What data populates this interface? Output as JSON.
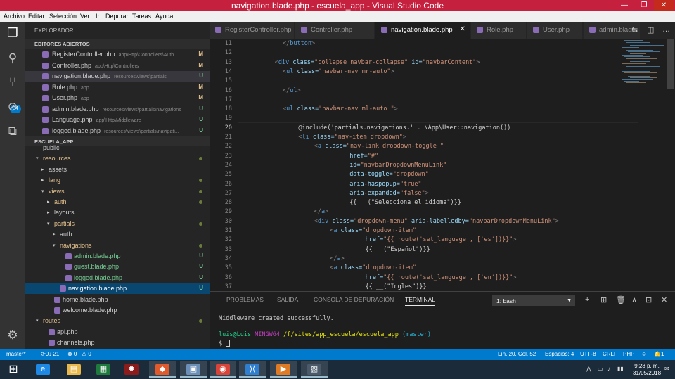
{
  "window": {
    "title": "navigation.blade.php - escuela_app - Visual Studio Code",
    "controls": [
      "—",
      "❐",
      "✕"
    ]
  },
  "colors": {
    "titlebar": "#c5203e",
    "statusbar": "#007acc",
    "modified": "#e2c08d",
    "untracked": "#73c991"
  },
  "menu": [
    "Archivo",
    "Editar",
    "Selección",
    "Ver",
    "Ir",
    "Depurar",
    "Tareas",
    "Ayuda"
  ],
  "activity": {
    "icons": [
      "files-icon",
      "search-icon",
      "source-control-icon",
      "debug-icon",
      "extensions-icon",
      "settings-gear-icon"
    ],
    "scm_badge": "34"
  },
  "explorer": {
    "header": "EXPLORADOR",
    "open_editors_title": "EDITORES ABIERTOS",
    "open_editors": [
      {
        "name": "RegisterController.php",
        "path": "app\\Http\\Controllers\\Auth",
        "status": "M"
      },
      {
        "name": "Controller.php",
        "path": "app\\Http\\Controllers",
        "status": "M"
      },
      {
        "name": "navigation.blade.php",
        "path": "resources\\views\\partials",
        "status": "U"
      },
      {
        "name": "Role.php",
        "path": "app",
        "status": "M"
      },
      {
        "name": "User.php",
        "path": "app",
        "status": "M"
      },
      {
        "name": "admin.blade.php",
        "path": "resources\\views\\partials\\navigations",
        "status": "U"
      },
      {
        "name": "Language.php",
        "path": "app\\Http\\Middleware",
        "status": "U"
      },
      {
        "name": "logged.blade.php",
        "path": "resources\\views\\partials\\navigati...",
        "status": "U"
      }
    ],
    "project_title": "ESCUELA_APP",
    "tree": [
      {
        "label": "public",
        "arrow": "",
        "indent": 0,
        "kind": "folder",
        "status": ""
      },
      {
        "label": "resources",
        "arrow": "▾",
        "indent": 0,
        "kind": "folder",
        "status": "dot"
      },
      {
        "label": "assets",
        "arrow": "▸",
        "indent": 1,
        "kind": "folder",
        "status": ""
      },
      {
        "label": "lang",
        "arrow": "▸",
        "indent": 1,
        "kind": "folder",
        "status": "dot"
      },
      {
        "label": "views",
        "arrow": "▾",
        "indent": 1,
        "kind": "folder",
        "status": "dot"
      },
      {
        "label": "auth",
        "arrow": "▸",
        "indent": 2,
        "kind": "folder",
        "status": "dot"
      },
      {
        "label": "layouts",
        "arrow": "▸",
        "indent": 2,
        "kind": "folder",
        "status": ""
      },
      {
        "label": "partials",
        "arrow": "▾",
        "indent": 2,
        "kind": "folder",
        "status": "dot"
      },
      {
        "label": "auth",
        "arrow": "▸",
        "indent": 3,
        "kind": "folder",
        "status": ""
      },
      {
        "label": "navigations",
        "arrow": "▾",
        "indent": 3,
        "kind": "folder",
        "status": "dot"
      },
      {
        "label": "admin.blade.php",
        "arrow": "",
        "indent": 4,
        "kind": "file",
        "status": "U"
      },
      {
        "label": "guest.blade.php",
        "arrow": "",
        "indent": 4,
        "kind": "file",
        "status": "U"
      },
      {
        "label": "logged.blade.php",
        "arrow": "",
        "indent": 4,
        "kind": "file",
        "status": "U"
      },
      {
        "label": "navigation.blade.php",
        "arrow": "",
        "indent": 3,
        "kind": "file",
        "status": "U",
        "selected": true
      },
      {
        "label": "home.blade.php",
        "arrow": "",
        "indent": 2,
        "kind": "file",
        "status": ""
      },
      {
        "label": "welcome.blade.php",
        "arrow": "",
        "indent": 2,
        "kind": "file",
        "status": ""
      },
      {
        "label": "routes",
        "arrow": "▾",
        "indent": 0,
        "kind": "folder",
        "status": "dot"
      },
      {
        "label": "api.php",
        "arrow": "",
        "indent": 1,
        "kind": "file",
        "status": ""
      },
      {
        "label": "channels.php",
        "arrow": "",
        "indent": 1,
        "kind": "file",
        "status": ""
      }
    ]
  },
  "tabs": [
    {
      "label": "RegisterController.php",
      "active": false
    },
    {
      "label": "Controller.php",
      "active": false
    },
    {
      "label": "navigation.blade.php",
      "active": true,
      "close": "✕"
    },
    {
      "label": "Role.php",
      "active": false
    },
    {
      "label": "User.php",
      "active": false
    },
    {
      "label": "admin.blade",
      "active": false
    }
  ],
  "editor": {
    "current_line": 20,
    "lines": [
      {
        "n": "11",
        "i": 10,
        "t": [
          [
            "t",
            "</"
          ],
          [
            "g",
            "button"
          ],
          [
            "t",
            ">"
          ]
        ]
      },
      {
        "n": "12",
        "i": 0,
        "t": []
      },
      {
        "n": "13",
        "i": 8,
        "t": [
          [
            "t",
            "<"
          ],
          [
            "g",
            "div"
          ],
          [
            "b",
            " class="
          ],
          [
            "o",
            "\"collapse navbar-collapse\""
          ],
          [
            "b",
            " id="
          ],
          [
            "o",
            "\"navbarContent\""
          ],
          [
            "t",
            ">"
          ]
        ]
      },
      {
        "n": "14",
        "i": 10,
        "t": [
          [
            "t",
            "<"
          ],
          [
            "g",
            "ul"
          ],
          [
            "b",
            " class="
          ],
          [
            "o",
            "\"navbar-nav mr-auto\""
          ],
          [
            "t",
            ">"
          ]
        ]
      },
      {
        "n": "15",
        "i": 0,
        "t": []
      },
      {
        "n": "16",
        "i": 10,
        "t": [
          [
            "t",
            "</"
          ],
          [
            "g",
            "ul"
          ],
          [
            "t",
            ">"
          ]
        ]
      },
      {
        "n": "17",
        "i": 0,
        "t": []
      },
      {
        "n": "18",
        "i": 10,
        "t": [
          [
            "t",
            "<"
          ],
          [
            "g",
            "ul"
          ],
          [
            "b",
            " class="
          ],
          [
            "o",
            "\"navbar-nav ml-auto \""
          ],
          [
            "t",
            ">"
          ]
        ]
      },
      {
        "n": "19",
        "i": 0,
        "t": []
      },
      {
        "n": "20",
        "i": 14,
        "t": [
          [
            "t",
            "@include('partials.navigations.' . \\App\\User::navigation())"
          ]
        ]
      },
      {
        "n": "21",
        "i": 14,
        "t": [
          [
            "t",
            "<"
          ],
          [
            "g",
            "li"
          ],
          [
            "b",
            " class="
          ],
          [
            "o",
            "\"nav-item dropdown\""
          ],
          [
            "t",
            ">"
          ]
        ]
      },
      {
        "n": "22",
        "i": 18,
        "t": [
          [
            "t",
            "<"
          ],
          [
            "g",
            "a"
          ],
          [
            "b",
            " class="
          ],
          [
            "o",
            "\"nav-link dropdown-toggle \""
          ]
        ]
      },
      {
        "n": "23",
        "i": 27,
        "t": [
          [
            "b",
            "href="
          ],
          [
            "o",
            "\"#\""
          ]
        ]
      },
      {
        "n": "24",
        "i": 27,
        "t": [
          [
            "b",
            "id="
          ],
          [
            "o",
            "\"navbarDropdownMenuLink\""
          ]
        ]
      },
      {
        "n": "25",
        "i": 27,
        "t": [
          [
            "b",
            "data-toggle="
          ],
          [
            "o",
            "\"dropdown\""
          ]
        ]
      },
      {
        "n": "26",
        "i": 27,
        "t": [
          [
            "b",
            "aria-haspopup="
          ],
          [
            "o",
            "\"true\""
          ]
        ]
      },
      {
        "n": "27",
        "i": 27,
        "t": [
          [
            "b",
            "aria-expanded="
          ],
          [
            "o",
            "\"false\""
          ],
          [
            "t",
            ">"
          ]
        ]
      },
      {
        "n": "28",
        "i": 27,
        "t": [
          [
            "t",
            "{{ __(\"Selecciona el idioma\")}}"
          ]
        ]
      },
      {
        "n": "29",
        "i": 18,
        "t": [
          [
            "t",
            "</"
          ],
          [
            "g",
            "a"
          ],
          [
            "t",
            ">"
          ]
        ]
      },
      {
        "n": "30",
        "i": 18,
        "t": [
          [
            "t",
            "<"
          ],
          [
            "g",
            "div"
          ],
          [
            "b",
            " class="
          ],
          [
            "o",
            "\"dropdown-menu\""
          ],
          [
            "b",
            " aria-labelledby="
          ],
          [
            "o",
            "\"navbarDropdownMenuLink\""
          ],
          [
            "t",
            ">"
          ]
        ]
      },
      {
        "n": "31",
        "i": 22,
        "t": [
          [
            "t",
            "<"
          ],
          [
            "g",
            "a"
          ],
          [
            "b",
            " class="
          ],
          [
            "o",
            "\"dropdown-item\""
          ]
        ]
      },
      {
        "n": "32",
        "i": 31,
        "t": [
          [
            "b",
            "href="
          ],
          [
            "o",
            "\"{{ route('set_language', ['es'])}}\""
          ],
          [
            "t",
            ">"
          ]
        ]
      },
      {
        "n": "33",
        "i": 31,
        "t": [
          [
            "t",
            "{{ __(\"Español\")}}"
          ]
        ]
      },
      {
        "n": "34",
        "i": 22,
        "t": [
          [
            "t",
            "</"
          ],
          [
            "g",
            "a"
          ],
          [
            "t",
            ">"
          ]
        ]
      },
      {
        "n": "35",
        "i": 22,
        "t": [
          [
            "t",
            "<"
          ],
          [
            "g",
            "a"
          ],
          [
            "b",
            " class="
          ],
          [
            "o",
            "\"dropdown-item\""
          ]
        ]
      },
      {
        "n": "36",
        "i": 31,
        "t": [
          [
            "b",
            "href="
          ],
          [
            "o",
            "\"{{ route('set_language', ['en'])}}\""
          ],
          [
            "t",
            ">"
          ]
        ]
      },
      {
        "n": "37",
        "i": 31,
        "t": [
          [
            "t",
            "{{ __(\"Ingles\")}}"
          ]
        ]
      }
    ]
  },
  "panel": {
    "tabs": [
      "PROBLEMAS",
      "SALIDA",
      "CONSOLA DE DEPURACIÓN",
      "TERMINAL"
    ],
    "active_tab": "TERMINAL",
    "terminal_select": "1: bash",
    "actions": [
      "+",
      "⊞",
      "🗑",
      "∧",
      "⊡",
      "✕"
    ],
    "lines": {
      "l1": "Middleware created successfully.",
      "prompt_user": "luis@Luis",
      "prompt_env": "MINGW64",
      "prompt_path": "/f/sites/app_escuela/escuela_app",
      "prompt_branch": "(master)",
      "cursor_line": "$ "
    }
  },
  "status": {
    "branch": "master*",
    "sync": "⟳0↓ 21",
    "errors": "⊗ 0",
    "warnings": "⚠ 0",
    "position": "Lín. 20, Col. 52",
    "spaces": "Espacios: 4",
    "encoding": "UTF-8",
    "eol": "CRLF",
    "language": "PHP",
    "feedback": "☺",
    "notifications": "🔔1"
  },
  "taskbar": {
    "apps": [
      {
        "name": "start-icon",
        "glyph": "⊞",
        "color": "#1b2b3a"
      },
      {
        "name": "ie-icon",
        "glyph": "e",
        "color": "#1e88e5"
      },
      {
        "name": "file-explorer-icon",
        "glyph": "▤",
        "color": "#e8b84a"
      },
      {
        "name": "excel-icon",
        "glyph": "▦",
        "color": "#1f7a3d"
      },
      {
        "name": "app-red-icon",
        "glyph": "✹",
        "color": "#8c1c1c"
      },
      {
        "name": "git-icon",
        "glyph": "◆",
        "color": "#e05a2b"
      },
      {
        "name": "virtualbox-icon",
        "glyph": "▣",
        "color": "#6c8fb8"
      },
      {
        "name": "chrome-icon",
        "glyph": "◉",
        "color": "#d9443a"
      },
      {
        "name": "vscode-icon",
        "glyph": "⟩⟨",
        "color": "#2f7fd1"
      },
      {
        "name": "media-player-icon",
        "glyph": "▶",
        "color": "#e07b25"
      },
      {
        "name": "terminal-icon",
        "glyph": "▧",
        "color": "#4a5a6a"
      }
    ],
    "time": "9:28 p. m.",
    "date": "31/05/2018",
    "tray": [
      "⋀",
      "▭",
      "♪",
      "✉",
      "▮▮"
    ]
  }
}
